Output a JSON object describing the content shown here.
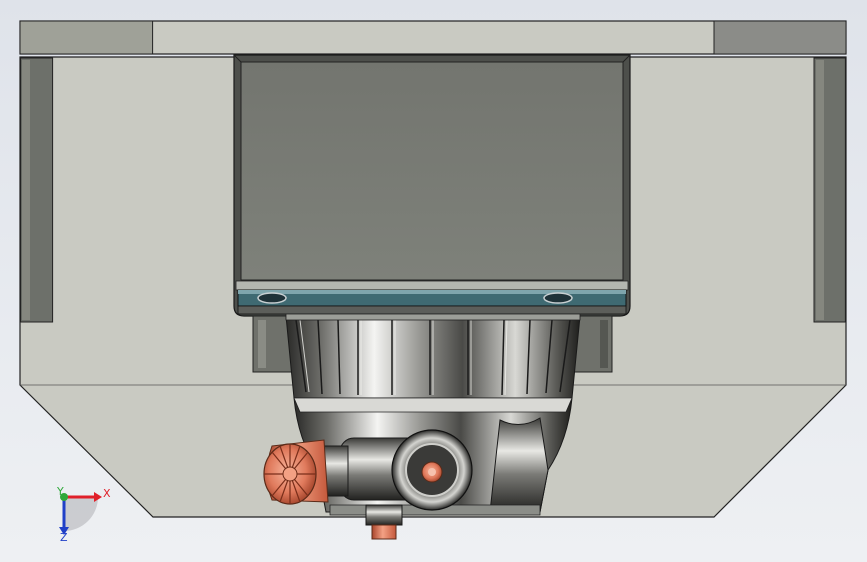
{
  "viewport": {
    "background_color": "#e4e7ec",
    "model_colors": {
      "frame_light": "#c9cac2",
      "frame_dark": "#6d706a",
      "frame_edge": "#222222",
      "housing": "#7a7c76",
      "metal_shine": "#f4f4f2",
      "metal_dark": "#2a2a28",
      "copper": "#e07a5c",
      "teal_plate": "#3f6a72"
    }
  },
  "triad": {
    "x_label": "X",
    "y_label": "Y",
    "z_label": "Z",
    "x_color": "#e0202a",
    "y_color": "#2fa83a",
    "z_color": "#2040c8"
  }
}
